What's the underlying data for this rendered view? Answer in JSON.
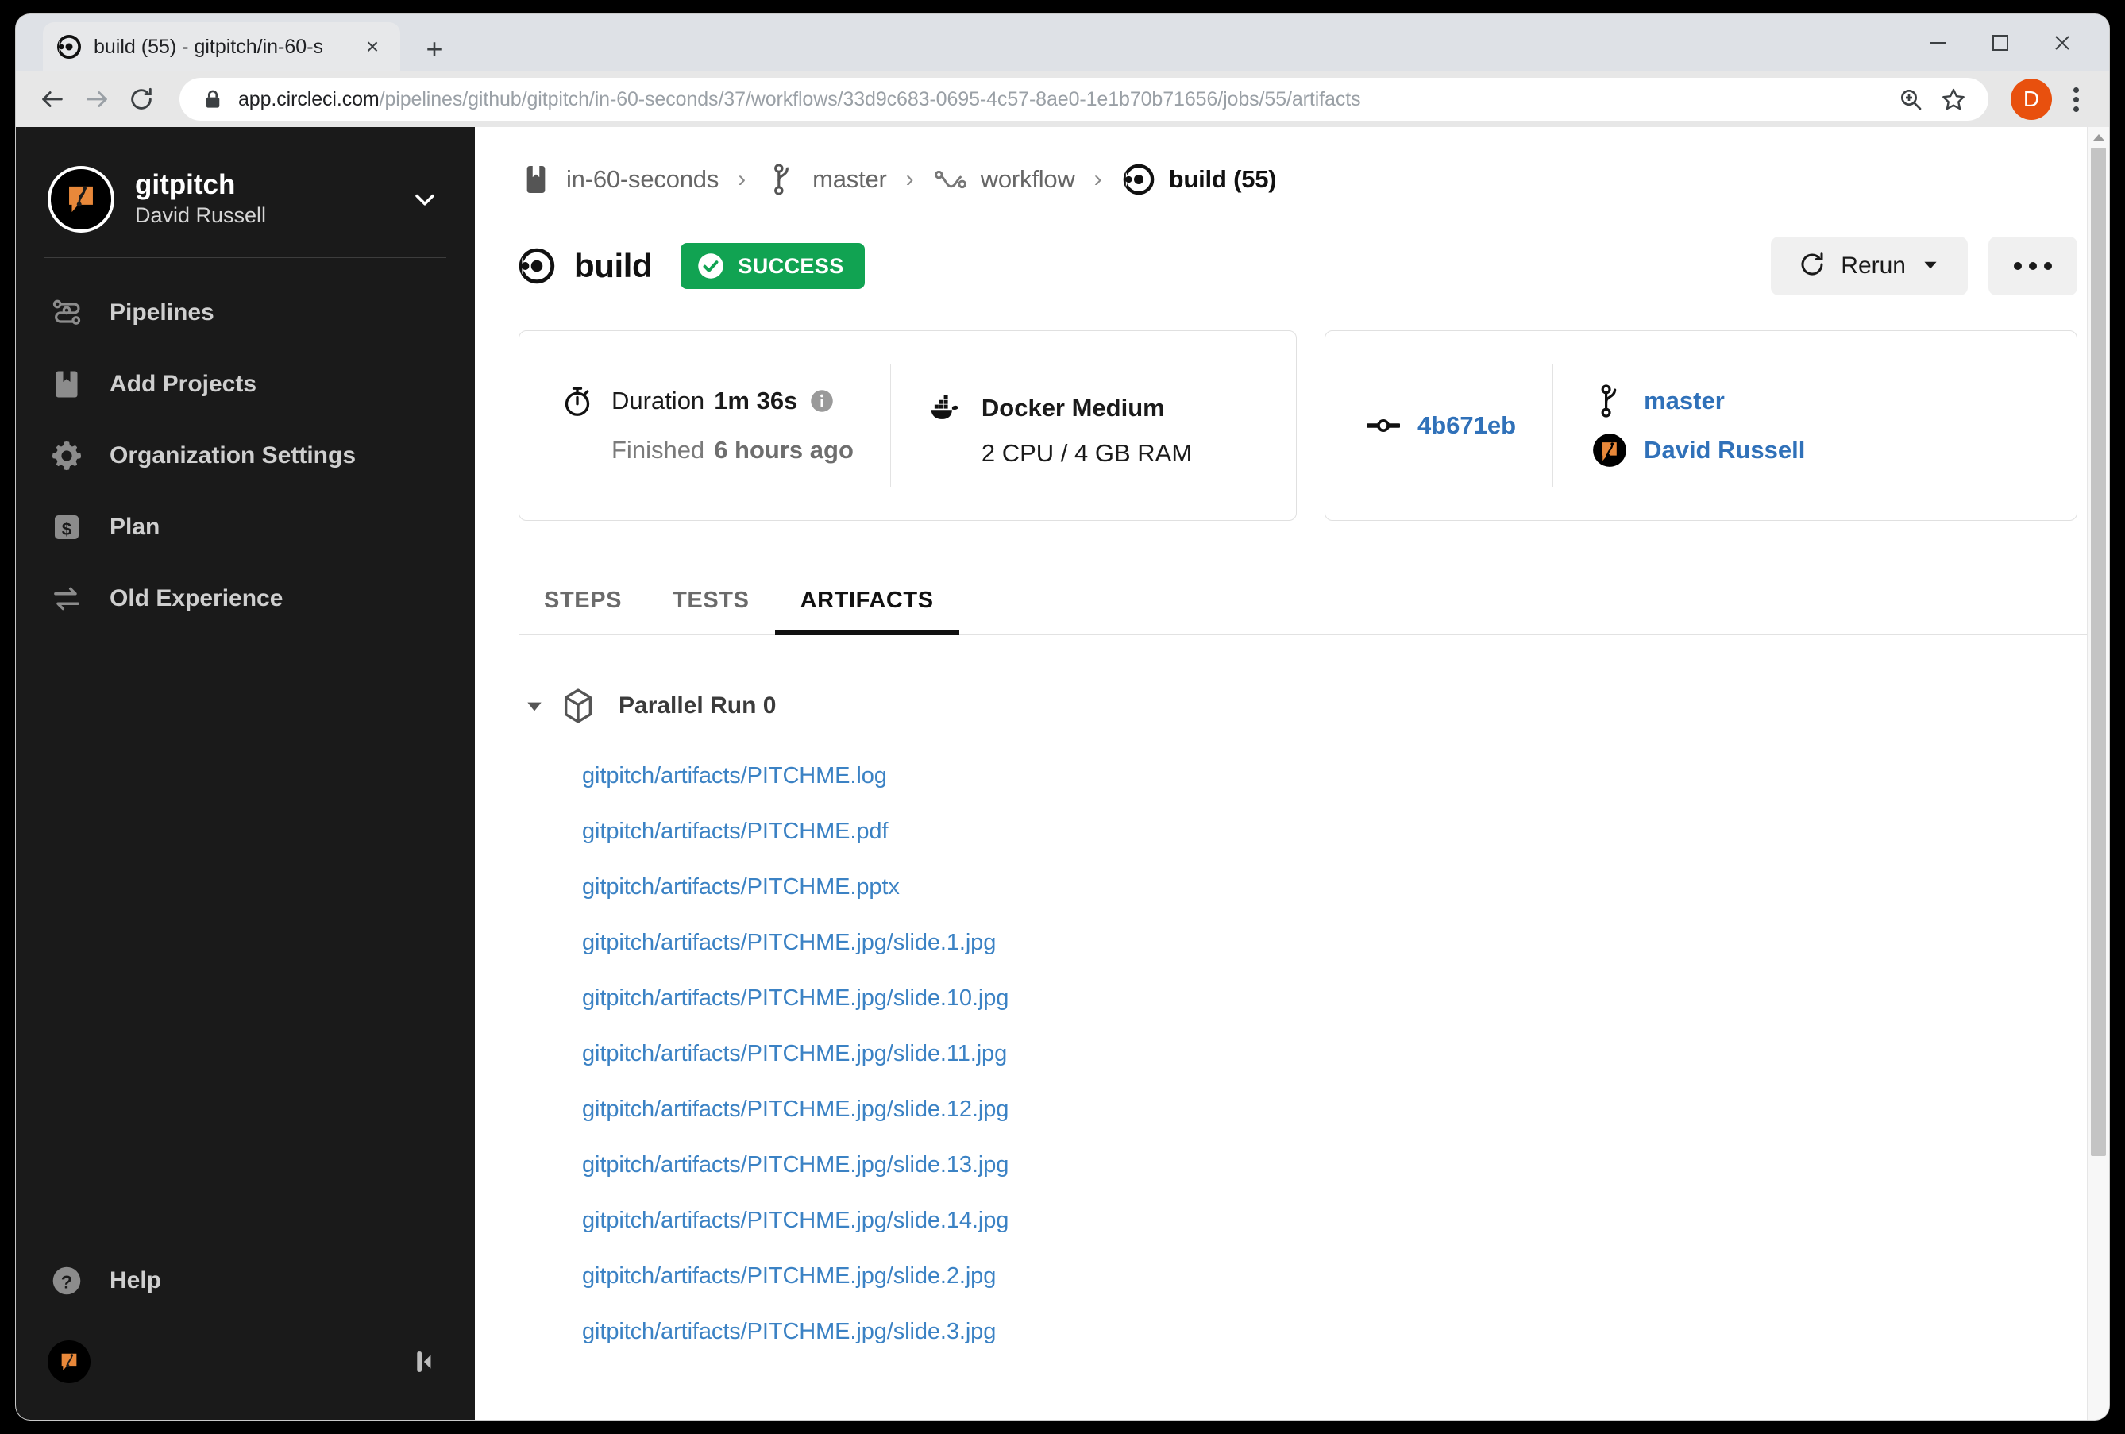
{
  "browser": {
    "tab": {
      "title": "build (55) - gitpitch/in-60-s",
      "favicon": "circleci-icon",
      "close": "×"
    },
    "new_tab_label": "+",
    "window_controls": {
      "minimize": "minimize-icon",
      "maximize": "maximize-icon",
      "close": "close-icon"
    },
    "url_host": "app.circleci.com",
    "url_path": "/pipelines/github/gitpitch/in-60-seconds/37/workflows/33d9c683-0695-4c57-8ae0-1e1b70b71656/jobs/55/artifacts",
    "profile_initial": "D"
  },
  "sidebar": {
    "org_name": "gitpitch",
    "org_user": "David Russell",
    "items": [
      {
        "label": "Pipelines",
        "icon": "pipelines-icon"
      },
      {
        "label": "Add Projects",
        "icon": "bookmark-icon"
      },
      {
        "label": "Organization Settings",
        "icon": "gear-icon"
      },
      {
        "label": "Plan",
        "icon": "dollar-icon"
      },
      {
        "label": "Old Experience",
        "icon": "swap-arrows-icon"
      }
    ],
    "help_label": "Help"
  },
  "breadcrumb": [
    {
      "label": "in-60-seconds",
      "icon": "project-icon"
    },
    {
      "label": "master",
      "icon": "branch-icon"
    },
    {
      "label": "workflow",
      "icon": "workflow-icon"
    },
    {
      "label": "build (55)",
      "icon": "circleci-icon"
    }
  ],
  "breadcrumb_separator": "›",
  "job": {
    "name": "build",
    "status": "SUCCESS",
    "status_color": "#11a352",
    "rerun_label": "Rerun",
    "more_label": "•••"
  },
  "details": {
    "duration_label": "Duration",
    "duration_value": "1m 36s",
    "finished_label": "Finished",
    "finished_value": "6 hours ago",
    "executor": "Docker Medium",
    "resources": "2 CPU / 4 GB RAM",
    "commit": "4b671eb",
    "branch": "master",
    "author": "David Russell"
  },
  "tabs": [
    {
      "label": "STEPS",
      "active": false
    },
    {
      "label": "TESTS",
      "active": false
    },
    {
      "label": "ARTIFACTS",
      "active": true
    }
  ],
  "artifacts": {
    "group_label": "Parallel Run 0",
    "files": [
      "gitpitch/artifacts/PITCHME.log",
      "gitpitch/artifacts/PITCHME.pdf",
      "gitpitch/artifacts/PITCHME.pptx",
      "gitpitch/artifacts/PITCHME.jpg/slide.1.jpg",
      "gitpitch/artifacts/PITCHME.jpg/slide.10.jpg",
      "gitpitch/artifacts/PITCHME.jpg/slide.11.jpg",
      "gitpitch/artifacts/PITCHME.jpg/slide.12.jpg",
      "gitpitch/artifacts/PITCHME.jpg/slide.13.jpg",
      "gitpitch/artifacts/PITCHME.jpg/slide.14.jpg",
      "gitpitch/artifacts/PITCHME.jpg/slide.2.jpg",
      "gitpitch/artifacts/PITCHME.jpg/slide.3.jpg"
    ]
  }
}
